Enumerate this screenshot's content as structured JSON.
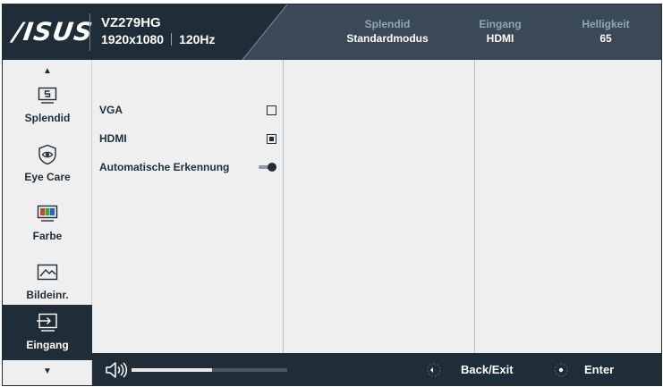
{
  "header": {
    "logo": "/ISUS",
    "model": "VZ279HG",
    "resolution": "1920x1080",
    "refresh": "120Hz",
    "status": [
      {
        "label": "Splendid",
        "value": "Standardmodus"
      },
      {
        "label": "Eingang",
        "value": "HDMI"
      },
      {
        "label": "Helligkeit",
        "value": "65"
      }
    ]
  },
  "sidebar": {
    "items": [
      {
        "label": "Splendid",
        "icon": "splendid-icon"
      },
      {
        "label": "Eye Care",
        "icon": "eye-care-icon"
      },
      {
        "label": "Farbe",
        "icon": "color-icon"
      },
      {
        "label": "Bildeinr.",
        "icon": "image-icon"
      },
      {
        "label": "Eingang",
        "icon": "input-icon",
        "active": true
      }
    ]
  },
  "input_menu": {
    "options": [
      {
        "label": "VGA",
        "state": "unchecked"
      },
      {
        "label": "HDMI",
        "state": "checked"
      },
      {
        "label": "Automatische Erkennung",
        "state": "toggle-on"
      }
    ]
  },
  "footer": {
    "volume_level": 0.52,
    "back_label": "Back/Exit",
    "enter_label": "Enter"
  },
  "colors": {
    "dark": "#1f2d38",
    "panel": "#efefef",
    "status_label": "#8ea6bc"
  }
}
